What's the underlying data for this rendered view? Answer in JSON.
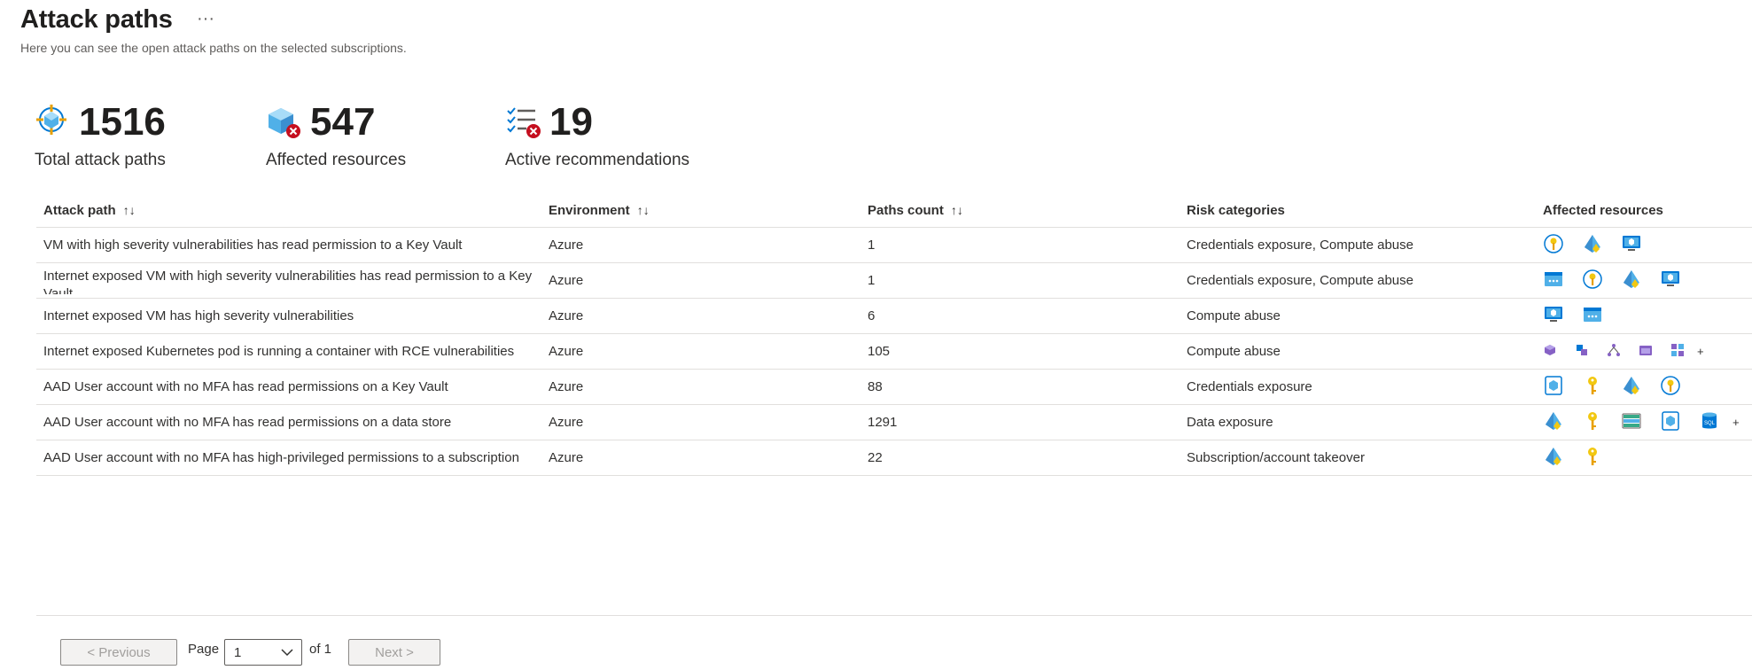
{
  "header": {
    "title": "Attack paths",
    "more": "···",
    "subtitle": "Here you can see the open attack paths on the selected subscriptions."
  },
  "kpis": [
    {
      "value": "1516",
      "label": "Total attack paths",
      "icon": "attack-path-icon"
    },
    {
      "value": "547",
      "label": "Affected resources",
      "icon": "affected-resource-icon"
    },
    {
      "value": "19",
      "label": "Active recommendations",
      "icon": "recommendations-icon"
    }
  ],
  "table": {
    "columns": [
      "Attack path",
      "Environment",
      "Paths count",
      "Risk categories",
      "Affected resources"
    ],
    "sort_glyph": "↑↓",
    "rows": [
      {
        "path": "VM with high severity vulnerabilities has read permission to a Key Vault",
        "env": "Azure",
        "count": "1",
        "risk": "Credentials exposure, Compute abuse",
        "resources": [
          "key-vault-icon",
          "managed-identity-icon",
          "virtual-machine-icon"
        ],
        "more": ""
      },
      {
        "path": "Internet exposed VM with high severity vulnerabilities has read permission to a Key Vault",
        "env": "Azure",
        "count": "1",
        "risk": "Credentials exposure, Compute abuse",
        "resources": [
          "public-ip-icon",
          "key-vault-icon",
          "managed-identity-icon",
          "virtual-machine-icon"
        ],
        "more": ""
      },
      {
        "path": "Internet exposed VM has high severity vulnerabilities",
        "env": "Azure",
        "count": "6",
        "risk": "Compute abuse",
        "resources": [
          "virtual-machine-icon",
          "public-ip-icon"
        ],
        "more": ""
      },
      {
        "path": "Internet exposed Kubernetes pod is running a container with RCE vulnerabilities",
        "env": "Azure",
        "count": "105",
        "risk": "Compute abuse",
        "resources": [
          "kubernetes-pod-icon",
          "kubernetes-container-icon",
          "kubernetes-service-icon",
          "kubernetes-namespace-icon",
          "kubernetes-cluster-icon"
        ],
        "more": "+"
      },
      {
        "path": "AAD User account with no MFA has read permissions on a Key Vault",
        "env": "Azure",
        "count": "88",
        "risk": "Credentials exposure",
        "resources": [
          "user-identity-icon",
          "key-icon",
          "managed-identity-icon",
          "key-vault-icon"
        ],
        "more": ""
      },
      {
        "path": "AAD User account with no MFA has read permissions on a data store",
        "env": "Azure",
        "count": "1291",
        "risk": "Data exposure",
        "resources": [
          "managed-identity-icon",
          "key-icon",
          "storage-account-icon",
          "user-identity-icon",
          "sql-database-icon"
        ],
        "more": "+"
      },
      {
        "path": "AAD User account with no MFA has high-privileged permissions to a subscription",
        "env": "Azure",
        "count": "22",
        "risk": "Subscription/account takeover",
        "resources": [
          "managed-identity-icon",
          "key-icon"
        ],
        "more": ""
      }
    ]
  },
  "pagination": {
    "previous": "< Previous",
    "page_label": "Page",
    "current_page": "1",
    "of_label": "of 1",
    "next": "Next >"
  }
}
